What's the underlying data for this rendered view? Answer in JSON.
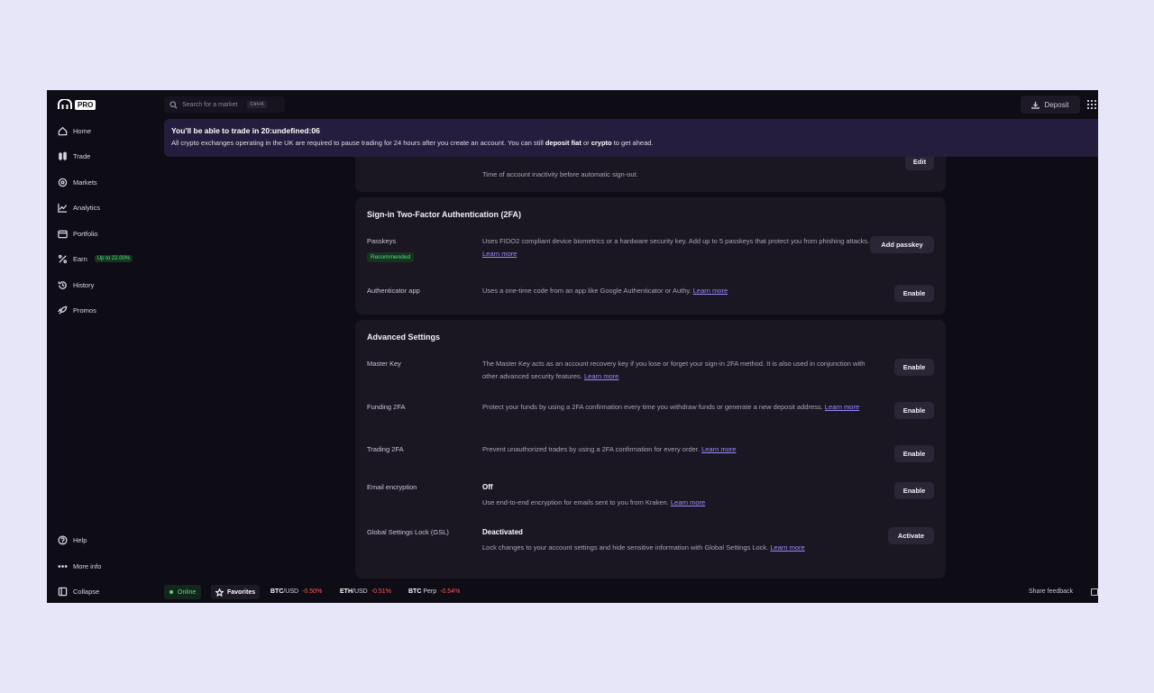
{
  "brand": {
    "logo_text": "PRO"
  },
  "sidebar": {
    "items": [
      {
        "label": "Home",
        "icon": "home-icon"
      },
      {
        "label": "Trade",
        "icon": "candles-icon"
      },
      {
        "label": "Markets",
        "icon": "markets-icon"
      },
      {
        "label": "Analytics",
        "icon": "analytics-icon"
      },
      {
        "label": "Portfolio",
        "icon": "portfolio-icon"
      },
      {
        "label": "Earn",
        "icon": "percent-icon",
        "badge": "Up to 22.00%"
      },
      {
        "label": "History",
        "icon": "history-icon"
      },
      {
        "label": "Promos",
        "icon": "rocket-icon"
      }
    ],
    "bottom": [
      {
        "label": "Help",
        "icon": "help-icon"
      },
      {
        "label": "More info",
        "icon": "ellipsis-icon"
      },
      {
        "label": "Collapse",
        "icon": "collapse-icon"
      }
    ]
  },
  "topbar": {
    "search_placeholder": "Search for a market",
    "search_shortcut": "Ctrl+K",
    "deposit_label": "Deposit"
  },
  "banner": {
    "title": "You'll be able to trade in 20:undefined:06",
    "text_before": "All crypto exchanges operating in the UK are required to pause trading for 24 hours after you create an account. You can still ",
    "bold1": "deposit fiat",
    "text_mid": " or ",
    "bold2": "crypto",
    "text_after": " to get ahead."
  },
  "top_card": {
    "desc": "Time of account inactivity before automatic sign-out.",
    "button": "Edit"
  },
  "twofa": {
    "title": "Sign-in Two-Factor Authentication (2FA)",
    "passkeys": {
      "label": "Passkeys",
      "badge": "Recommended",
      "desc": "Uses FIDO2 compliant device biometrics or a hardware security key. Add up to 5 passkeys that protect you from phishing attacks.",
      "link": "Learn more",
      "button": "Add passkey"
    },
    "authenticator": {
      "label": "Authenticator app",
      "desc": "Uses a one-time code from an app like Google Authenticator or Authy.",
      "link": "Learn more",
      "button": "Enable"
    }
  },
  "advanced": {
    "title": "Advanced Settings",
    "master_key": {
      "label": "Master Key",
      "desc": "The Master Key acts as an account recovery key if you lose or forget your sign-in 2FA method. It is also used in conjunction with other advanced security features.",
      "link": "Learn more",
      "button": "Enable"
    },
    "funding": {
      "label": "Funding 2FA",
      "desc": "Protect your funds by using a 2FA confirmation every time you withdraw funds or generate a new deposit address.",
      "link": "Learn more",
      "button": "Enable"
    },
    "trading": {
      "label": "Trading 2FA",
      "desc": "Prevent unauthorized trades by using a 2FA confirmation for every order.",
      "link": "Learn more",
      "button": "Enable"
    },
    "email": {
      "label": "Email encryption",
      "status": "Off",
      "desc": "Use end-to-end encryption for emails sent to you from Kraken.",
      "link": "Learn more",
      "button": "Enable"
    },
    "gsl": {
      "label": "Global Settings Lock (GSL)",
      "status": "Deactivated",
      "desc": "Lock changes to your account settings and hide sensitive information with Global Settings Lock.",
      "link": "Learn more",
      "button": "Activate"
    }
  },
  "footer": {
    "online": "Online",
    "favorites": "Favorites",
    "tickers": [
      {
        "base": "BTC",
        "quote": "/USD",
        "change": "-0.50%"
      },
      {
        "base": "ETH",
        "quote": "/USD",
        "change": "-0.51%"
      },
      {
        "base": "BTC",
        "quote": " Perp",
        "change": "-0.54%"
      }
    ],
    "share_feedback": "Share feedback"
  },
  "colors": {
    "app_bg": "#0e0c15",
    "card_bg": "#1a1722",
    "banner_bg": "#251d3d",
    "link": "#9b8cff",
    "positive": "#4ee07a",
    "negative": "#ff5a5a"
  }
}
